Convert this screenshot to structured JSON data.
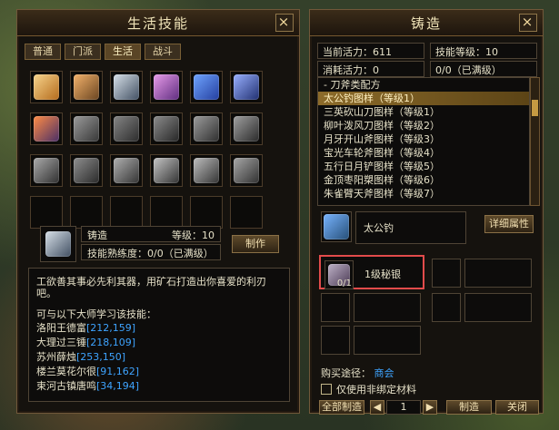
{
  "left_panel": {
    "title": "生活技能",
    "close_icon": "×",
    "tabs": [
      "普通",
      "门派",
      "生活",
      "战斗"
    ],
    "skills_icons": [
      "chicken-icon",
      "cauldron-icon",
      "anvil-icon",
      "pick-icon",
      "lamp-icon",
      "heron-icon",
      "alchemy-icon",
      "fish-icon",
      "herb-icon",
      "claw-icon",
      "stone-icon",
      "muscle-icon",
      "mortar-icon",
      "grind-icon",
      "scroll-icon",
      "spiral-icon",
      "mushroom-icon",
      "body-icon",
      "empty",
      "empty",
      "empty",
      "empty",
      "empty",
      "empty"
    ],
    "selected_skill": {
      "name": "铸造",
      "level_label": "等级：10",
      "proficiency_label": "技能熟练度：0/0（已满级）",
      "make_button": "制作"
    },
    "description": {
      "line1": "工欲善其事必先利其器，用矿石打造出你喜爱的利刃吧。",
      "line2": "可与以下大师学习该技能：",
      "masters": [
        {
          "name": "洛阳王德富",
          "coord": "[212,159]"
        },
        {
          "name": "大理过三锤",
          "coord": "[218,109]"
        },
        {
          "name": "苏州薛烛",
          "coord": "[253,150]"
        },
        {
          "name": "楼兰莫花尔很",
          "coord": "[91,162]"
        },
        {
          "name": "束河古镇唐鸣",
          "coord": "[34,194]"
        }
      ]
    }
  },
  "right_panel": {
    "title": "铸造",
    "close_icon": "×",
    "current_energy": "当前活力：611",
    "skill_level": "技能等级：10",
    "consume_energy": "消耗活力：0",
    "proficiency_short": "0/0（已满级）",
    "recipe_category": "刀斧类配方",
    "recipes": [
      "太公钓图样（等级1）",
      "三英砍山刀图样（等级1）",
      "柳叶泼风刀图样（等级2）",
      "月牙开山斧图样（等级3）",
      "宝光车轮斧图样（等级4）",
      "五行日月铲图样（等级5）",
      "金顶枣阳槊图样（等级6）",
      "朱雀臂天斧图样（等级7）"
    ],
    "selected_item": "太公钓",
    "detail_button": "详细属性",
    "material": "1级秘银",
    "material_count": "0/1",
    "purchase_label": "购买途径：",
    "purchase_link": "商会",
    "checkbox_label": "仅使用非绑定材料",
    "quantity": "1",
    "buttons": {
      "make_all": "全部制造",
      "make": "制造",
      "close": "关闭"
    }
  }
}
